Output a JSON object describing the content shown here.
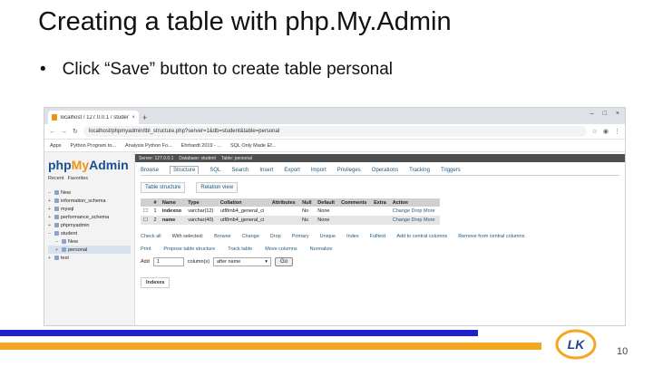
{
  "slide": {
    "title": "Creating a table with php.My.Admin",
    "bullet": "Click “Save” button to create table personal",
    "page_number": "10",
    "logo_text": "LK"
  },
  "browser": {
    "tab_title": "localhost / 127.0.0.1 / student / ...",
    "tab_close": "×",
    "new_tab": "+",
    "url": "localhost/phpmyadmin/tbl_structure.php?server=1&db=student&table=personal",
    "bookmarks": [
      "Apps",
      "Python Program to...",
      "Analysis Python Fo...",
      "Ehrhardt 2019 - ...",
      "SQL Only Made Ef..."
    ]
  },
  "pma": {
    "logo_php": "php",
    "logo_my": "My",
    "logo_admin": "Admin",
    "side_links": [
      "Recent",
      "Favorites"
    ],
    "tree": [
      {
        "label": "New",
        "level": 0
      },
      {
        "label": "information_schema",
        "level": 0
      },
      {
        "label": "mysql",
        "level": 0
      },
      {
        "label": "performance_schema",
        "level": 0
      },
      {
        "label": "phpmyadmin",
        "level": 0
      },
      {
        "label": "student",
        "level": 0
      },
      {
        "label": "New",
        "level": 1
      },
      {
        "label": "personal",
        "level": 1
      },
      {
        "label": "test",
        "level": 0
      }
    ],
    "breadcrumb": [
      "Server: 127.0.0.1",
      "Database: student",
      "Table: personal"
    ],
    "menu_tabs": [
      "Browse",
      "Structure",
      "SQL",
      "Search",
      "Insert",
      "Export",
      "Import",
      "Privileges",
      "Operations",
      "Tracking",
      "Triggers"
    ],
    "sub_tabs": [
      "Table structure",
      "Relation view"
    ],
    "columns": [
      "#",
      "Name",
      "Type",
      "Collation",
      "Attributes",
      "Null",
      "Default",
      "Comments",
      "Extra",
      "Action"
    ],
    "rows": [
      {
        "num": "1",
        "name": "indexno",
        "type": "varchar(12)",
        "collation": "utf8mb4_general_ci",
        "attributes": "",
        "null": "No",
        "default": "None",
        "comments": "",
        "extra": "",
        "change": "Change",
        "drop": "Drop",
        "more": "More"
      },
      {
        "num": "2",
        "name": "name",
        "type": "varchar(40)",
        "collation": "utf8mb4_general_ci",
        "attributes": "",
        "null": "No",
        "default": "None",
        "comments": "",
        "extra": "",
        "change": "Change",
        "drop": "Drop",
        "more": "More"
      }
    ],
    "row_actions": [
      "Check all",
      "With selected:",
      "Browse",
      "Change",
      "Drop",
      "Primary",
      "Unique",
      "Index",
      "Fulltext",
      "Add to central columns",
      "Remove from central columns"
    ],
    "table_actions": [
      "Print",
      "Propose table structure",
      "Track table",
      "Move columns",
      "Normalize"
    ],
    "add_label": "Add",
    "add_value": "1",
    "add_unit": "column(s)",
    "add_position": "after name",
    "go_label": "Go",
    "indexes_label": "Indexes"
  },
  "colors": {
    "blue_bar": "#1f1fd0",
    "orange_bar": "#f5a623",
    "pma_blue": "#1a4f8f",
    "pma_orange": "#f29111"
  }
}
